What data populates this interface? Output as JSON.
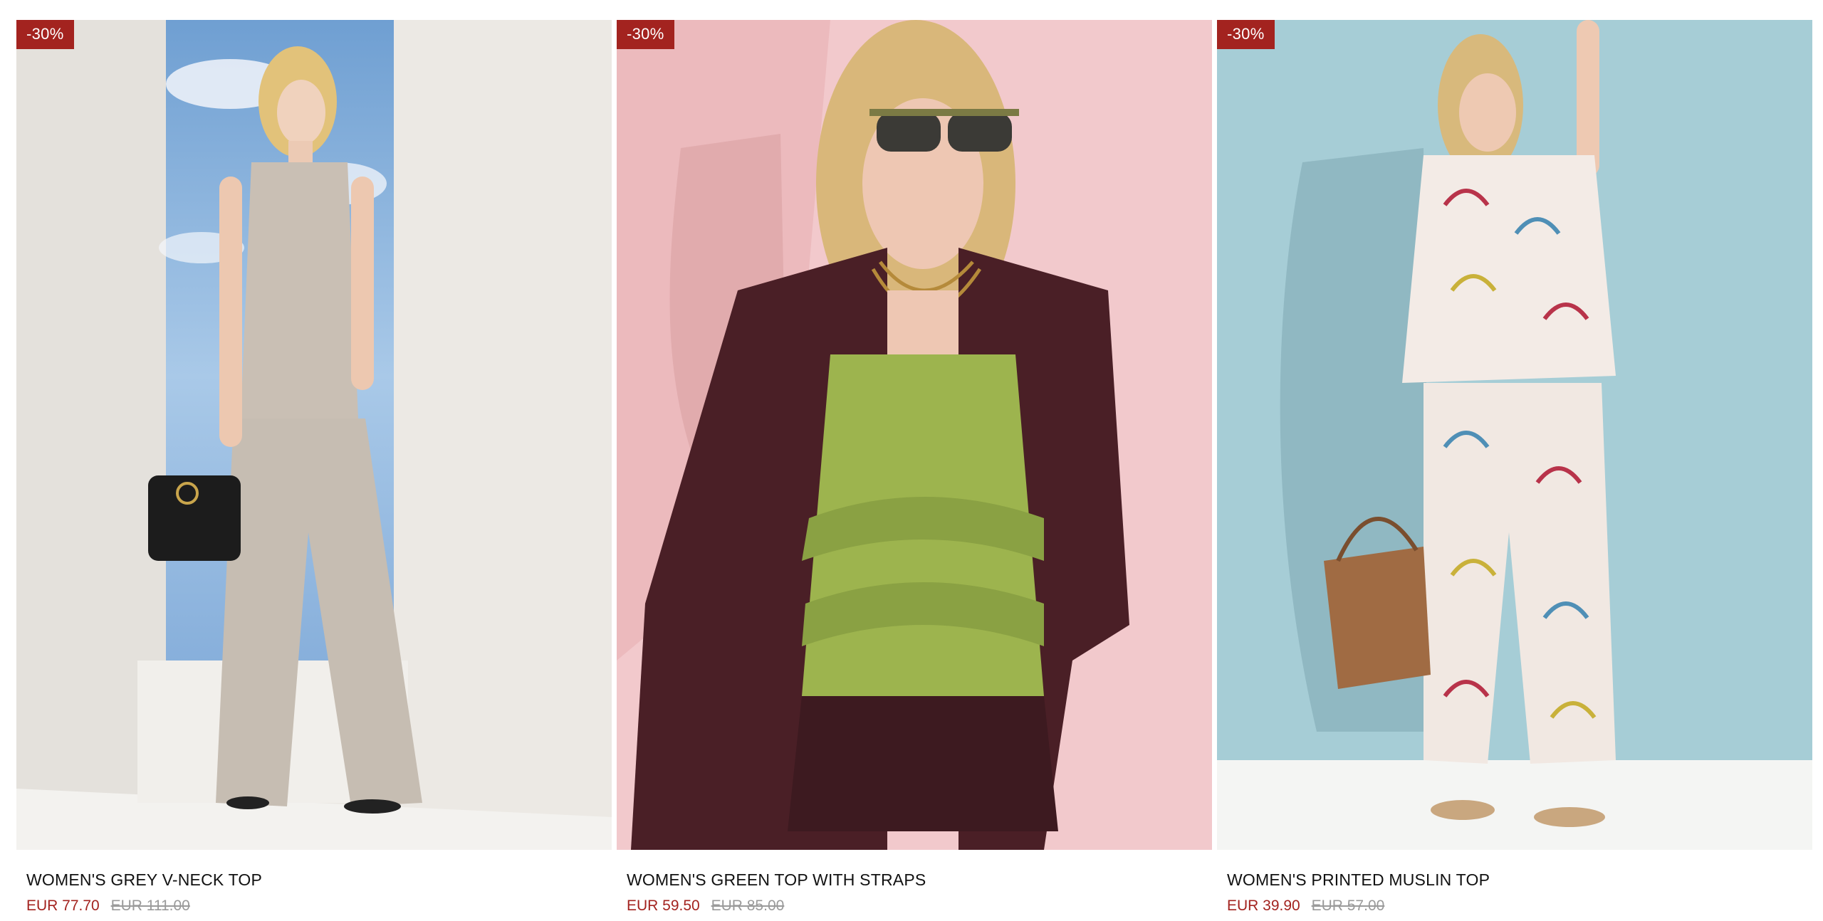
{
  "colors": {
    "badge_bg": "#a3231f",
    "sale_price": "#a3231f",
    "old_price": "#9a9a9a",
    "title_text": "#111111"
  },
  "products": [
    {
      "badge": "-30%",
      "name": "WOMEN'S GREY V-NECK TOP",
      "price_sale": "EUR 77.70",
      "price_old": "EUR 111.00",
      "image_alt": "model-grey-outfit"
    },
    {
      "badge": "-30%",
      "name": "WOMEN'S GREEN TOP WITH STRAPS",
      "price_sale": "EUR 59.50",
      "price_old": "EUR 85.00",
      "image_alt": "model-green-top"
    },
    {
      "badge": "-30%",
      "name": "WOMEN'S PRINTED MUSLIN TOP",
      "price_sale": "EUR 39.90",
      "price_old": "EUR 57.00",
      "image_alt": "model-printed-set"
    }
  ]
}
